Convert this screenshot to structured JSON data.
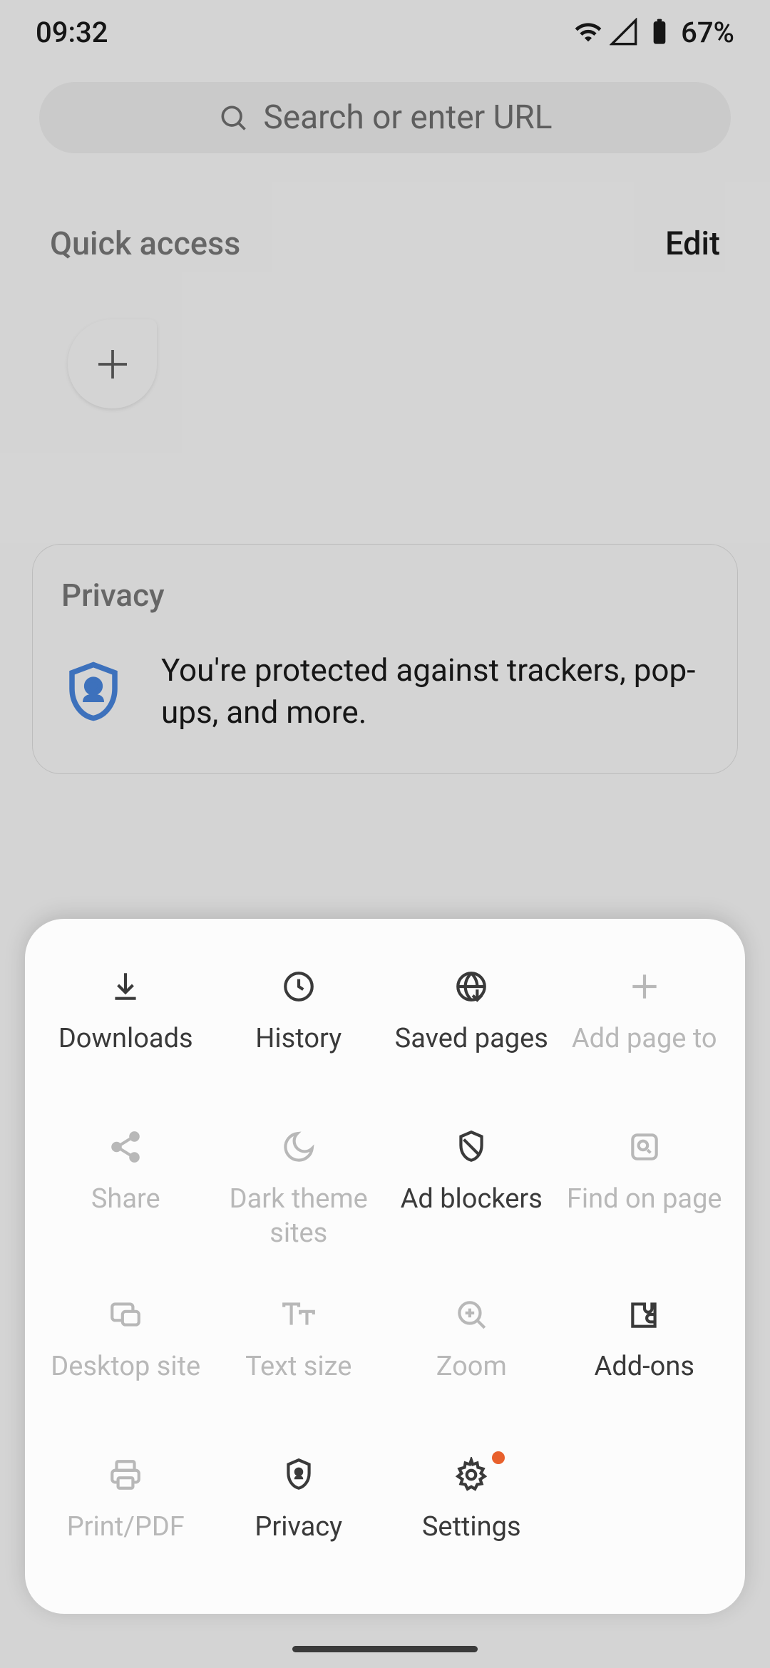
{
  "status": {
    "time": "09:32",
    "battery": "67%"
  },
  "search": {
    "placeholder": "Search or enter URL"
  },
  "quickAccess": {
    "title": "Quick access",
    "edit": "Edit"
  },
  "privacy": {
    "title": "Privacy",
    "text": "You're protected against trackers, pop-ups, and more."
  },
  "sheet": {
    "items": [
      {
        "label": "Downloads",
        "icon": "download",
        "enabled": true
      },
      {
        "label": "History",
        "icon": "clock",
        "enabled": true
      },
      {
        "label": "Saved pages",
        "icon": "globe-down",
        "enabled": true
      },
      {
        "label": "Add page to",
        "icon": "plus",
        "enabled": false
      },
      {
        "label": "Share",
        "icon": "share",
        "enabled": false
      },
      {
        "label": "Dark theme sites",
        "icon": "moon",
        "enabled": false
      },
      {
        "label": "Ad blockers",
        "icon": "shield-slash",
        "enabled": true
      },
      {
        "label": "Find on page",
        "icon": "find",
        "enabled": false
      },
      {
        "label": "Desktop site",
        "icon": "desktop",
        "enabled": false
      },
      {
        "label": "Text size",
        "icon": "text-size",
        "enabled": false
      },
      {
        "label": "Zoom",
        "icon": "zoom",
        "enabled": false
      },
      {
        "label": "Add-ons",
        "icon": "puzzle",
        "enabled": true
      },
      {
        "label": "Print/PDF",
        "icon": "printer",
        "enabled": false
      },
      {
        "label": "Privacy",
        "icon": "shield-person",
        "enabled": true
      },
      {
        "label": "Settings",
        "icon": "gear",
        "enabled": true,
        "dot": true
      }
    ]
  }
}
